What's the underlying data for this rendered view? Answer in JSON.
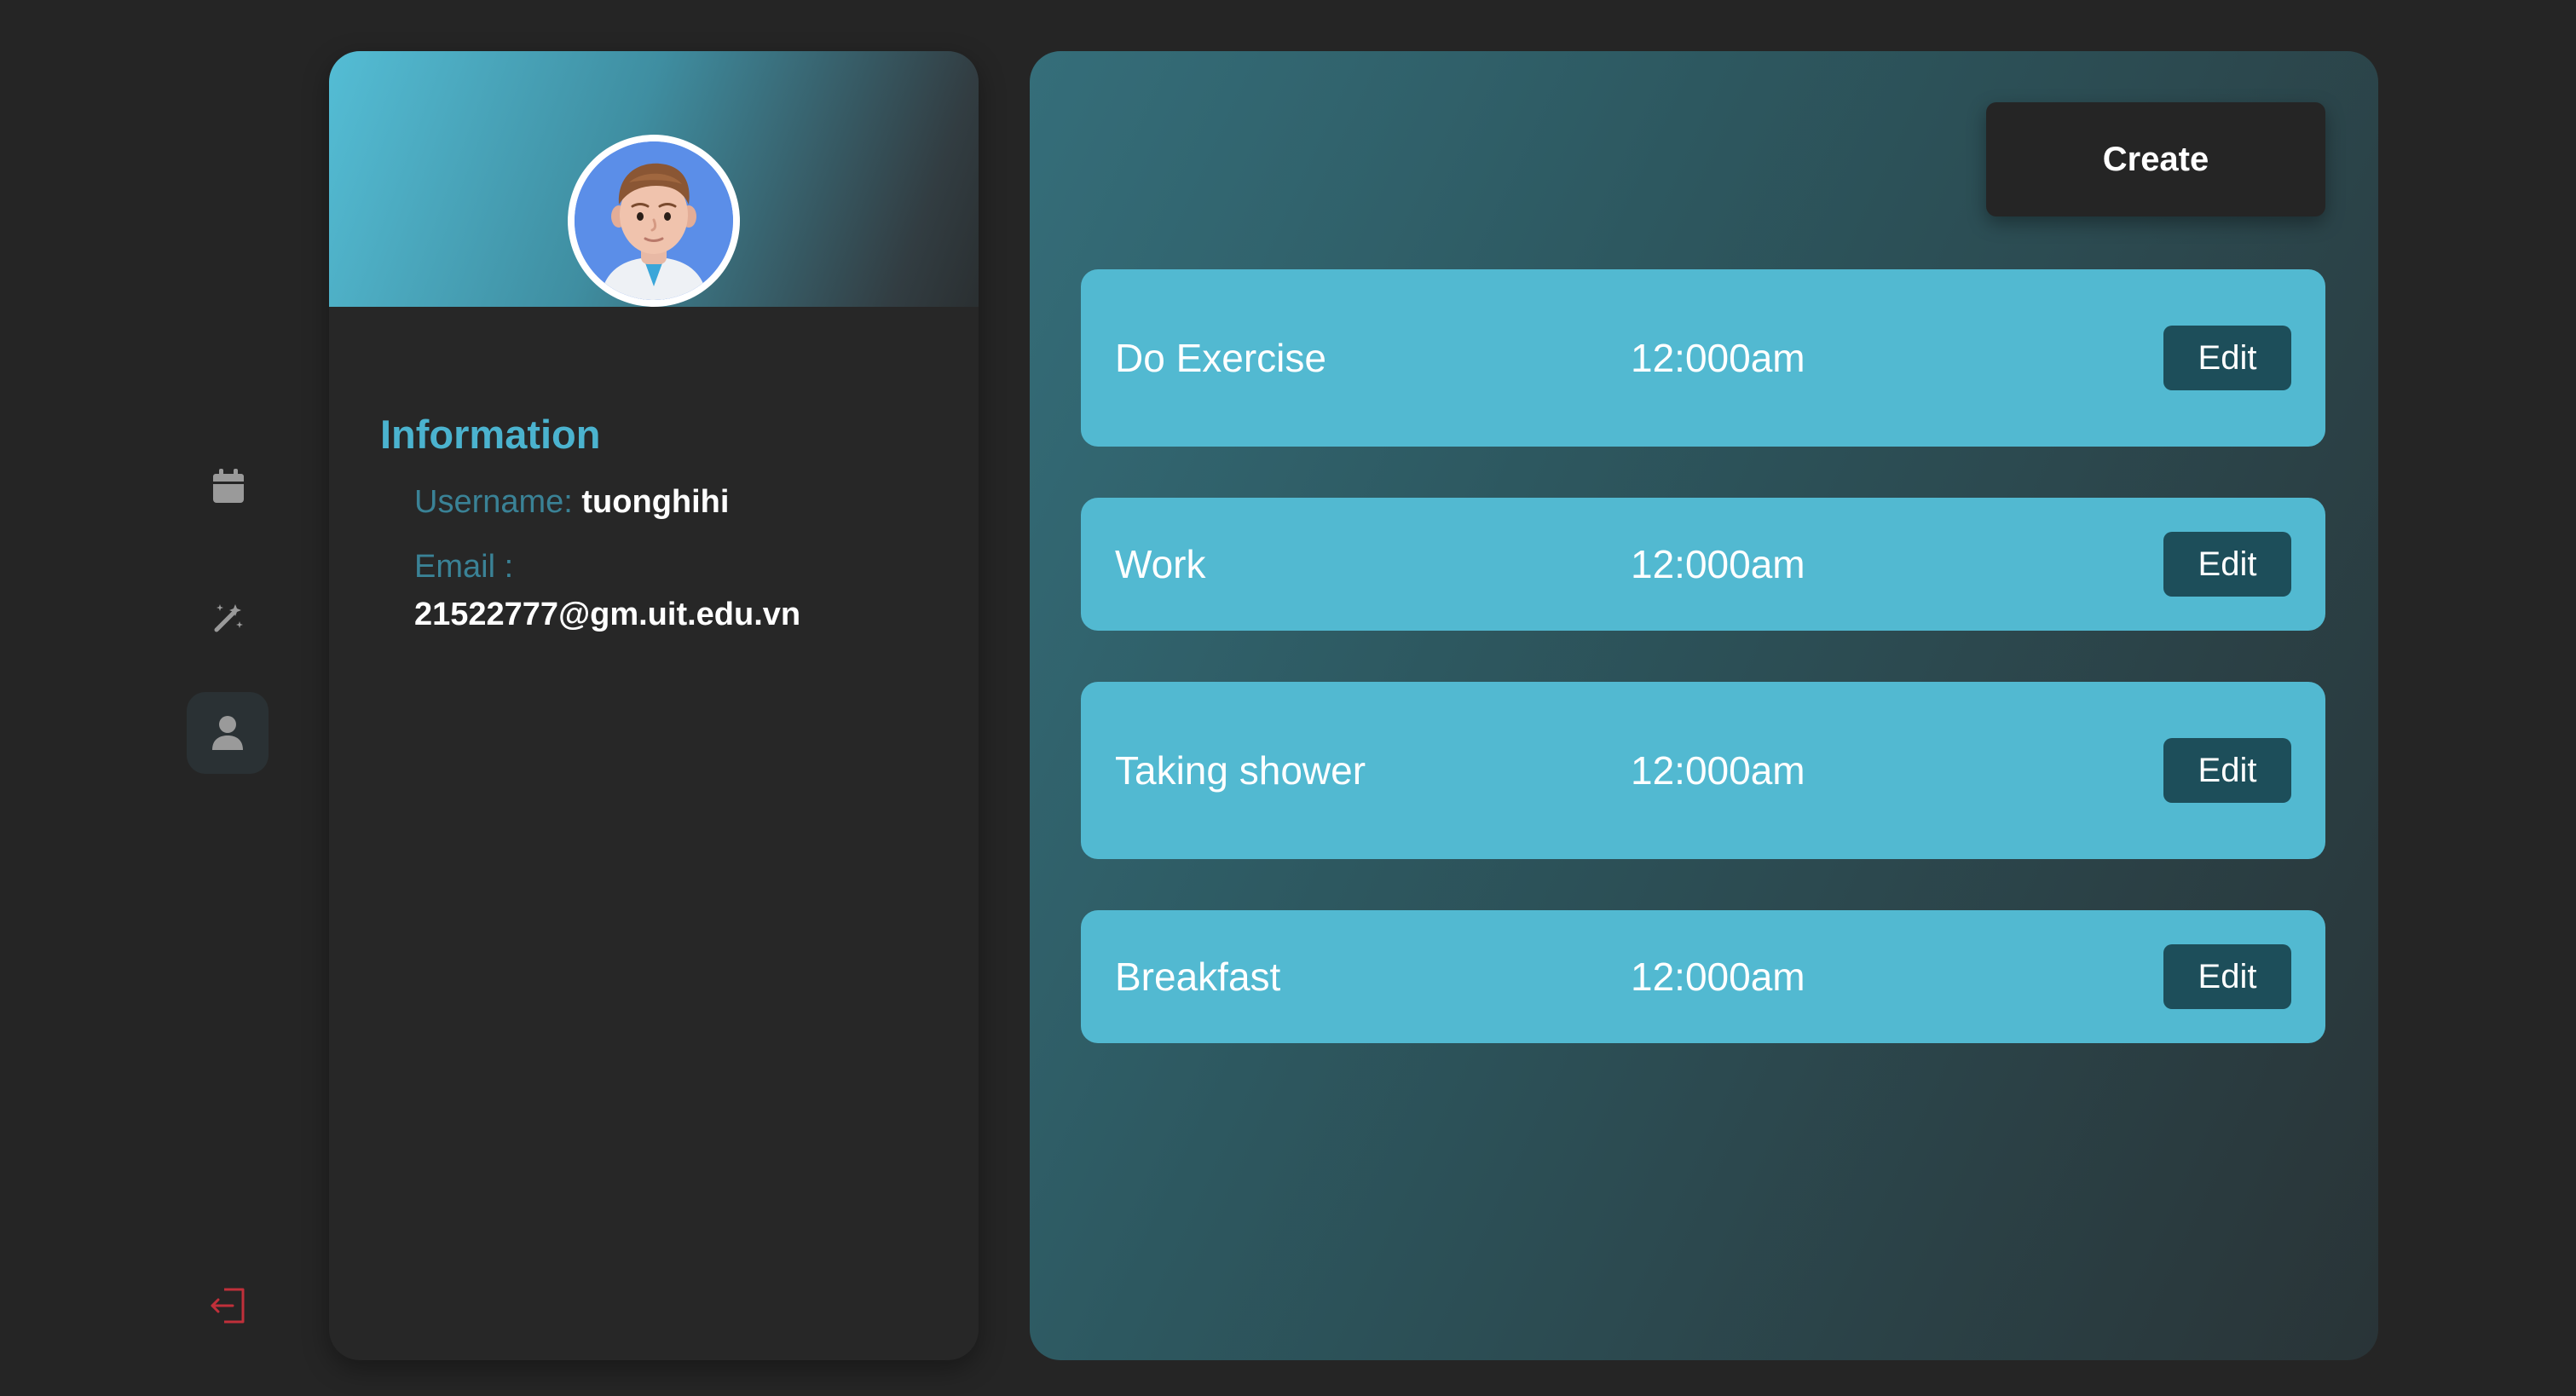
{
  "sidebar": {
    "items": [
      {
        "icon": "calendar-icon",
        "active": false
      },
      {
        "icon": "magic-wand-icon",
        "active": false
      },
      {
        "icon": "user-icon",
        "active": true
      }
    ],
    "logout_icon": "logout-icon"
  },
  "profile": {
    "avatar": "avatar",
    "section_title": "Information",
    "username_label": "Username:",
    "username": "tuonghihi",
    "email_label": "Email :",
    "email": "21522777@gm.uit.edu.vn"
  },
  "tasks": {
    "create_label": "Create",
    "items": [
      {
        "name": "Do Exercise",
        "time": "12:000am",
        "edit_label": "Edit"
      },
      {
        "name": "Work",
        "time": "12:000am",
        "edit_label": "Edit"
      },
      {
        "name": "Taking shower",
        "time": "12:000am",
        "edit_label": "Edit"
      },
      {
        "name": "Breakfast",
        "time": "12:000am",
        "edit_label": "Edit"
      }
    ]
  },
  "colors": {
    "background": "#252525",
    "accent": "#52b9d1",
    "edit_button": "#1d4e5a",
    "logout": "#c0303a",
    "label": "#3a8296"
  }
}
